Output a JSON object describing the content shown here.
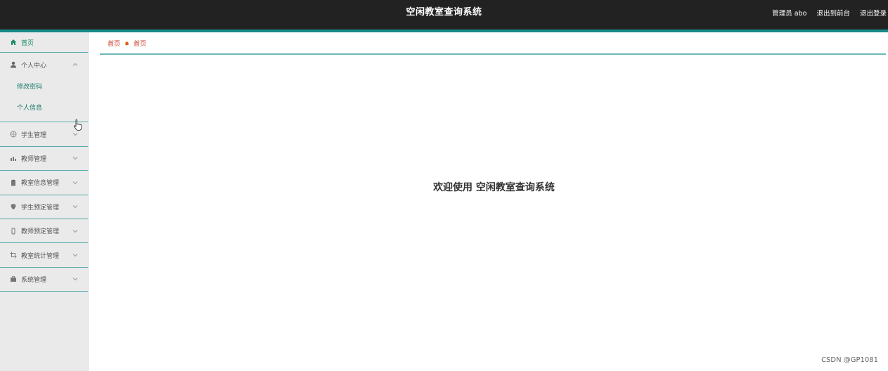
{
  "header": {
    "title": "空闲教室查询系统",
    "user": "管理员 abo",
    "to_frontend": "退出到前台",
    "logout": "退出登录"
  },
  "sidebar": {
    "items": [
      {
        "label": "首页",
        "icon": "home-icon"
      },
      {
        "label": "个人中心",
        "icon": "user-icon",
        "expanded": true,
        "children": [
          {
            "label": "修改密码"
          },
          {
            "label": "个人信息"
          }
        ]
      },
      {
        "label": "学生管理",
        "icon": "circle-icon"
      },
      {
        "label": "教师管理",
        "icon": "chart-icon"
      },
      {
        "label": "教室信息管理",
        "icon": "clipboard-icon"
      },
      {
        "label": "学生预定管理",
        "icon": "shield-icon"
      },
      {
        "label": "教师预定管理",
        "icon": "phone-icon"
      },
      {
        "label": "教室统计管理",
        "icon": "crop-icon"
      },
      {
        "label": "系统管理",
        "icon": "briefcase-icon"
      }
    ]
  },
  "breadcrumb": {
    "items": [
      "首页",
      "首页"
    ]
  },
  "main": {
    "welcome": "欢迎使用 空闲教室查询系统"
  },
  "watermark": "CSDN @GP1081",
  "colors": {
    "topbar": "#222222",
    "accent": "#1a8a8a",
    "sidebar_bg": "#eaeaea",
    "crumb": "#cc3b2a"
  }
}
